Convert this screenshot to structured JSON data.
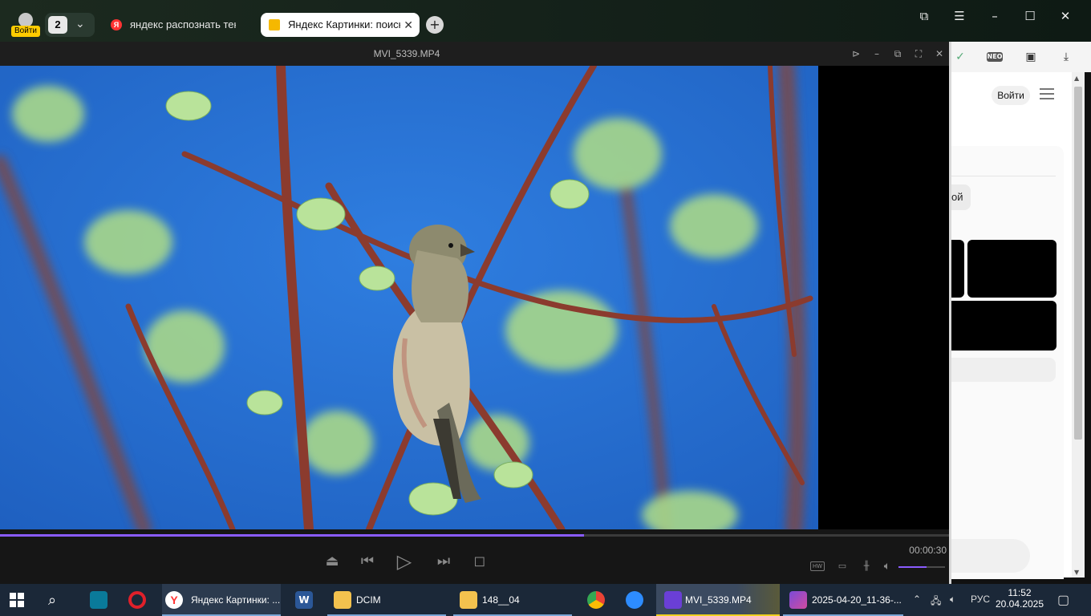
{
  "browser": {
    "profile_label": "Войти",
    "tab_count": "2",
    "tabs": [
      {
        "title": "яндекс распознать текст с",
        "icon": "yandex-icon"
      },
      {
        "title": "Яндекс Картинки: поиск",
        "icon": "image-icon"
      }
    ],
    "page": {
      "login": "Войти",
      "chip_text": "ой"
    }
  },
  "player": {
    "title": "MVI_5339.MP4",
    "time": "00:00:30",
    "hw_label": "HW",
    "progress": 0.615,
    "volume": 0.6
  },
  "taskbar": {
    "items": [
      {
        "label": "Яндекс Картинки: ...",
        "icon": "yandex-browser-icon"
      },
      {
        "label": "DCIM",
        "icon": "folder-icon"
      },
      {
        "label": "148__04",
        "icon": "folder-icon"
      },
      {
        "label": "MVI_5339.MP4",
        "icon": "video-player-icon"
      },
      {
        "label": "2025-04-20_11-36-...",
        "icon": "image-editor-icon"
      }
    ],
    "lang": "РУС",
    "time": "11:52",
    "date": "20.04.2025"
  },
  "colors": {
    "accent": "#8a5cff",
    "sky": "#2a73d4",
    "taskbar": "#1b2838"
  }
}
